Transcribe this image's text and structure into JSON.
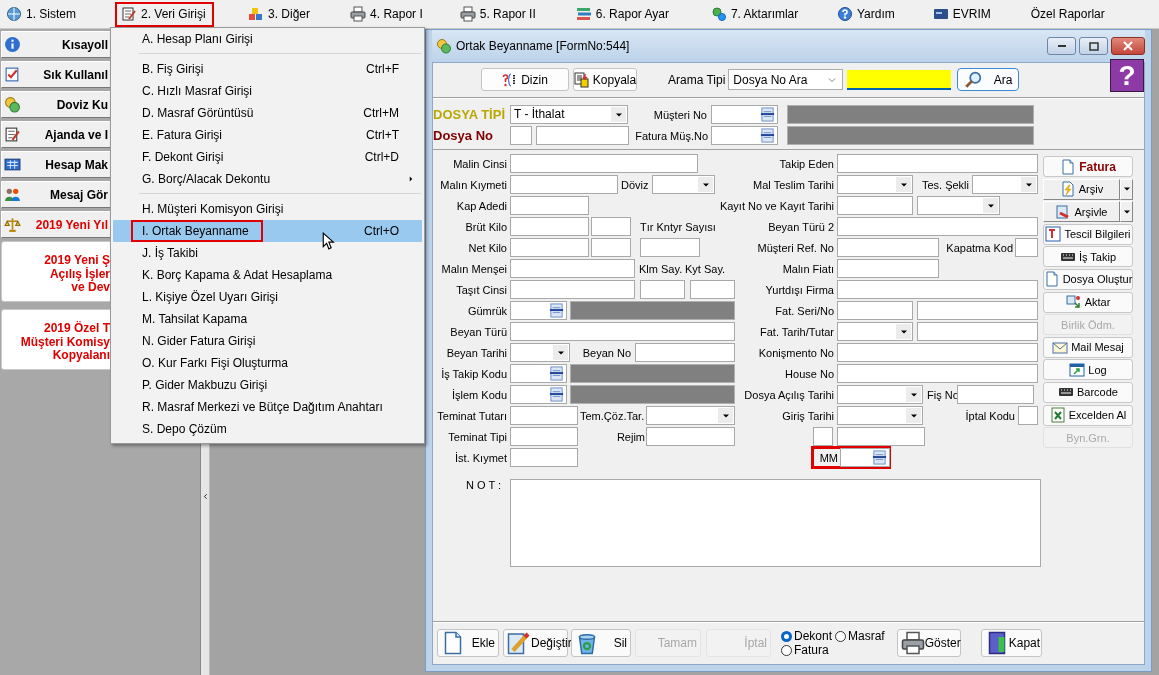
{
  "menu_bar": [
    {
      "label": "1. Sistem",
      "highlighted": false
    },
    {
      "label": "2. Veri Girişi",
      "highlighted": true
    },
    {
      "label": "3. Diğer",
      "highlighted": false
    },
    {
      "label": "4. Rapor I",
      "highlighted": false
    },
    {
      "label": "5. Rapor II",
      "highlighted": false
    },
    {
      "label": "6. Rapor Ayar",
      "highlighted": false
    },
    {
      "label": "7. Aktarımlar",
      "highlighted": false
    },
    {
      "label": "Yardım",
      "highlighted": false
    },
    {
      "label": "EVRIM",
      "highlighted": false
    },
    {
      "label": "Özel Raporlar",
      "highlighted": false
    }
  ],
  "sidebar": [
    {
      "kind": "button",
      "label": "Kısayoll",
      "alert": false
    },
    {
      "kind": "button",
      "label": "Sık Kullanıl",
      "alert": false
    },
    {
      "kind": "button",
      "label": "Doviz Ku",
      "alert": false
    },
    {
      "kind": "button",
      "label": "Ajanda ve I",
      "alert": false
    },
    {
      "kind": "button",
      "label": "Hesap Mak",
      "alert": false
    },
    {
      "kind": "button",
      "label": "Mesaj Gör",
      "alert": false
    },
    {
      "kind": "button",
      "label": "2019 Yeni Yıl",
      "alert": true
    },
    {
      "kind": "card",
      "lines": [
        "2019 Yeni Ş",
        "Açılış İşler",
        "ve Dev"
      ],
      "alert": true
    },
    {
      "kind": "card",
      "lines": [
        "2019 Özel T",
        "Müşteri Komisy",
        "Kopyalanı"
      ],
      "alert": true
    }
  ],
  "dropdown_menu": [
    {
      "kind": "item",
      "label": "A. Hesap Planı Girişi",
      "submenu": false,
      "selected": false,
      "highlighted": false
    },
    {
      "kind": "separator"
    },
    {
      "kind": "item",
      "label": "B. Fiş Girişi",
      "shortcut": "Ctrl+F",
      "submenu": false,
      "selected": false,
      "highlighted": false
    },
    {
      "kind": "item",
      "label": "C. Hızlı Masraf Girişi",
      "submenu": false,
      "selected": false,
      "highlighted": false
    },
    {
      "kind": "item",
      "label": "D. Masraf Görüntüsü",
      "shortcut": "Ctrl+M",
      "submenu": false,
      "selected": false,
      "highlighted": false
    },
    {
      "kind": "item",
      "label": "E. Fatura Girişi",
      "shortcut": "Ctrl+T",
      "submenu": false,
      "selected": false,
      "highlighted": false
    },
    {
      "kind": "item",
      "label": "F. Dekont Girişi",
      "shortcut": "Ctrl+D",
      "submenu": false,
      "selected": false,
      "highlighted": false
    },
    {
      "kind": "item",
      "label": "G. Borç/Alacak Dekontu",
      "submenu": true,
      "selected": false,
      "highlighted": false
    },
    {
      "kind": "separator"
    },
    {
      "kind": "item",
      "label": "H. Müşteri Komisyon Girişi",
      "submenu": false,
      "selected": false,
      "highlighted": false
    },
    {
      "kind": "item",
      "label": "I. Ortak Beyanname",
      "shortcut": "Ctrl+O",
      "submenu": false,
      "selected": true,
      "highlighted": true
    },
    {
      "kind": "item",
      "label": "J. İş Takibi",
      "submenu": false,
      "selected": false,
      "highlighted": false
    },
    {
      "kind": "item",
      "label": "K. Borç Kapama & Adat Hesaplama",
      "submenu": false,
      "selected": false,
      "highlighted": false
    },
    {
      "kind": "item",
      "label": "L. Kişiye Özel Uyarı Girişi",
      "submenu": false,
      "selected": false,
      "highlighted": false
    },
    {
      "kind": "item",
      "label": "M. Tahsilat Kapama",
      "submenu": false,
      "selected": false,
      "highlighted": false
    },
    {
      "kind": "item",
      "label": "N. Gider Fatura Girişi",
      "submenu": false,
      "selected": false,
      "highlighted": false
    },
    {
      "kind": "item",
      "label": "O. Kur Farkı Fişi Oluşturma",
      "submenu": false,
      "selected": false,
      "highlighted": false
    },
    {
      "kind": "item",
      "label": "P. Gider Makbuzu Girişi",
      "submenu": false,
      "selected": false,
      "highlighted": false
    },
    {
      "kind": "item",
      "label": "R. Masraf Merkezi ve Bütçe Dağıtım Anahtarı",
      "submenu": false,
      "selected": false,
      "highlighted": false
    },
    {
      "kind": "item",
      "label": "S. Depo Çözüm",
      "submenu": false,
      "selected": false,
      "highlighted": false
    }
  ],
  "form_window": {
    "title": "Ortak Beyanname [FormNo:544]",
    "toolbar": {
      "index_button": "Dizin",
      "copy_button": "Kopyala",
      "search_type_label": "Arama Tipi",
      "search_type": "Dosya No Ara",
      "search_button": "Ara",
      "help_button": "?"
    },
    "header_rows": [
      [
        {
          "kind": "label",
          "text": "DOSYA TİPİ",
          "color": "#b8a800"
        },
        {
          "kind": "combo",
          "value": "T - İthalat"
        },
        {
          "kind": "label",
          "text": "Müşteri No"
        },
        {
          "kind": "lookup"
        },
        {
          "kind": "gray"
        }
      ],
      [
        {
          "kind": "label",
          "text": "Dosya No",
          "color": "#800000"
        },
        {
          "kind": "text"
        },
        {
          "kind": "text"
        },
        {
          "kind": "label",
          "text": "Fatura Müş.No"
        },
        {
          "kind": "lookup"
        },
        {
          "kind": "gray"
        }
      ]
    ],
    "left_rows": [
      [
        {
          "kind": "label",
          "text": "Malin Cinsi"
        },
        {
          "kind": "text"
        }
      ],
      [
        {
          "kind": "label",
          "text": "Malın Kıymeti"
        },
        {
          "kind": "text"
        },
        {
          "kind": "label",
          "text": "Döviz"
        },
        {
          "kind": "combo"
        }
      ],
      [
        {
          "kind": "label",
          "text": "Kap Adedi"
        },
        {
          "kind": "text"
        }
      ],
      [
        {
          "kind": "label",
          "text": "Brüt Kilo"
        },
        {
          "kind": "text"
        },
        {
          "kind": "text"
        },
        {
          "kind": "label",
          "text": "Tır Kntyr Sayısı"
        }
      ],
      [
        {
          "kind": "label",
          "text": "Net Kilo"
        },
        {
          "kind": "text"
        },
        {
          "kind": "text"
        },
        {
          "kind": "text"
        }
      ],
      [
        {
          "kind": "label",
          "text": "Malın Menşei"
        },
        {
          "kind": "text"
        },
        {
          "kind": "label",
          "text": "Klm Say."
        },
        {
          "kind": "label",
          "text": "Kyt Say."
        }
      ],
      [
        {
          "kind": "label",
          "text": "Taşıt Cinsi"
        },
        {
          "kind": "text"
        },
        {
          "kind": "text"
        },
        {
          "kind": "text"
        }
      ],
      [
        {
          "kind": "label",
          "text": "Gümrük"
        },
        {
          "kind": "lookup"
        },
        {
          "kind": "gray"
        }
      ],
      [
        {
          "kind": "label",
          "text": "Beyan Türü"
        },
        {
          "kind": "text"
        }
      ],
      [
        {
          "kind": "label",
          "text": "Beyan Tarihi"
        },
        {
          "kind": "combo"
        },
        {
          "kind": "label",
          "text": "Beyan No"
        },
        {
          "kind": "text"
        }
      ],
      [
        {
          "kind": "label",
          "text": "İş Takip Kodu"
        },
        {
          "kind": "lookup"
        },
        {
          "kind": "gray"
        }
      ],
      [
        {
          "kind": "label",
          "text": "İşlem Kodu"
        },
        {
          "kind": "lookup"
        },
        {
          "kind": "gray"
        }
      ],
      [
        {
          "kind": "label",
          "text": "Teminat Tutarı"
        },
        {
          "kind": "text"
        },
        {
          "kind": "label",
          "text": "Tem.Çöz.Tar."
        },
        {
          "kind": "combo"
        }
      ],
      [
        {
          "kind": "label",
          "text": "Teminat Tipi"
        },
        {
          "kind": "text"
        },
        {
          "kind": "label",
          "text": "Rejim"
        },
        {
          "kind": "text"
        }
      ],
      [
        {
          "kind": "label",
          "text": "İst. Kıymet"
        },
        {
          "kind": "text"
        }
      ]
    ],
    "right_rows": [
      [
        {
          "kind": "label",
          "text": "Takip Eden"
        },
        {
          "kind": "text"
        }
      ],
      [
        {
          "kind": "label",
          "text": "Mal Teslim Tarihi"
        },
        {
          "kind": "combo"
        },
        {
          "kind": "label",
          "text": "Tes. Şekli"
        },
        {
          "kind": "combo"
        }
      ],
      [
        {
          "kind": "label",
          "text": "Kayıt No ve Kayıt Tarihi"
        },
        {
          "kind": "text"
        },
        {
          "kind": "combo"
        }
      ],
      [
        {
          "kind": "label",
          "text": "Beyan Türü 2"
        },
        {
          "kind": "text"
        }
      ],
      [
        {
          "kind": "label",
          "text": "Müşteri Ref. No"
        },
        {
          "kind": "text"
        },
        {
          "kind": "label",
          "text": "Kapatma Kod"
        },
        {
          "kind": "text"
        }
      ],
      [
        {
          "kind": "label",
          "text": "Malın Fiatı"
        },
        {
          "kind": "text"
        }
      ],
      [
        {
          "kind": "label",
          "text": "Yurtdışı Firma"
        },
        {
          "kind": "text"
        }
      ],
      [
        {
          "kind": "label",
          "text": "Fat. Seri/No"
        },
        {
          "kind": "text"
        },
        {
          "kind": "text"
        }
      ],
      [
        {
          "kind": "label",
          "text": "Fat. Tarih/Tutar"
        },
        {
          "kind": "combo"
        },
        {
          "kind": "text"
        }
      ],
      [
        {
          "kind": "label",
          "text": "Konişmento No"
        },
        {
          "kind": "text"
        }
      ],
      [
        {
          "kind": "label",
          "text": "House No"
        },
        {
          "kind": "text"
        }
      ],
      [
        {
          "kind": "label",
          "text": "Dosya Açılış Tarihi"
        },
        {
          "kind": "combo"
        },
        {
          "kind": "label",
          "text": "Fiş No"
        },
        {
          "kind": "text"
        }
      ],
      [
        {
          "kind": "label",
          "text": "Giriş Tarihi"
        },
        {
          "kind": "combo"
        },
        {
          "kind": "label",
          "text": "İptal Kodu"
        },
        {
          "kind": "text"
        }
      ],
      [
        {
          "kind": "text"
        },
        {
          "kind": "text"
        }
      ],
      [
        {
          "kind": "frame",
          "highlighted": true,
          "controls": [
            {
              "kind": "label",
              "text": "MM"
            },
            {
              "kind": "lookup"
            }
          ]
        }
      ]
    ],
    "side_buttons": [
      {
        "kind": "primary",
        "label": "Fatura",
        "disabled": false
      },
      {
        "kind": "split",
        "label": "Arşiv",
        "disabled": false
      },
      {
        "kind": "split",
        "label": "Arşivle",
        "disabled": false
      },
      {
        "kind": "plain",
        "label": "Tescil Bilgileri",
        "disabled": false
      },
      {
        "kind": "plain",
        "label": "İş Takip",
        "disabled": false
      },
      {
        "kind": "plain",
        "label": "Dosya Oluştur",
        "disabled": false
      },
      {
        "kind": "plain",
        "label": "Aktar",
        "disabled": false
      },
      {
        "kind": "plain",
        "label": "Birlik Ödm.",
        "disabled": true
      },
      {
        "kind": "plain",
        "label": "Mail Mesaj",
        "disabled": false
      },
      {
        "kind": "plain",
        "label": "Log",
        "disabled": false
      },
      {
        "kind": "plain",
        "label": "Barcode",
        "disabled": false
      },
      {
        "kind": "plain",
        "label": "Excelden Al",
        "disabled": false
      },
      {
        "kind": "plain",
        "label": "Byn.Grn.",
        "disabled": true
      }
    ],
    "note_label": "N O T :",
    "bottom_buttons": [
      {
        "label": "Ekle",
        "disabled": false
      },
      {
        "label": "Değiştir",
        "disabled": false
      },
      {
        "label": "Sil",
        "disabled": false
      },
      {
        "label": "Tamam",
        "disabled": true
      },
      {
        "label": "İptal",
        "disabled": true
      },
      {
        "label": "Göster",
        "disabled": false
      },
      {
        "label": "Kapat",
        "disabled": false
      }
    ],
    "print_options": [
      {
        "label": "Dekont",
        "selected": true
      },
      {
        "label": "Masraf",
        "selected": false
      },
      {
        "label": "Fatura",
        "selected": false
      }
    ]
  }
}
